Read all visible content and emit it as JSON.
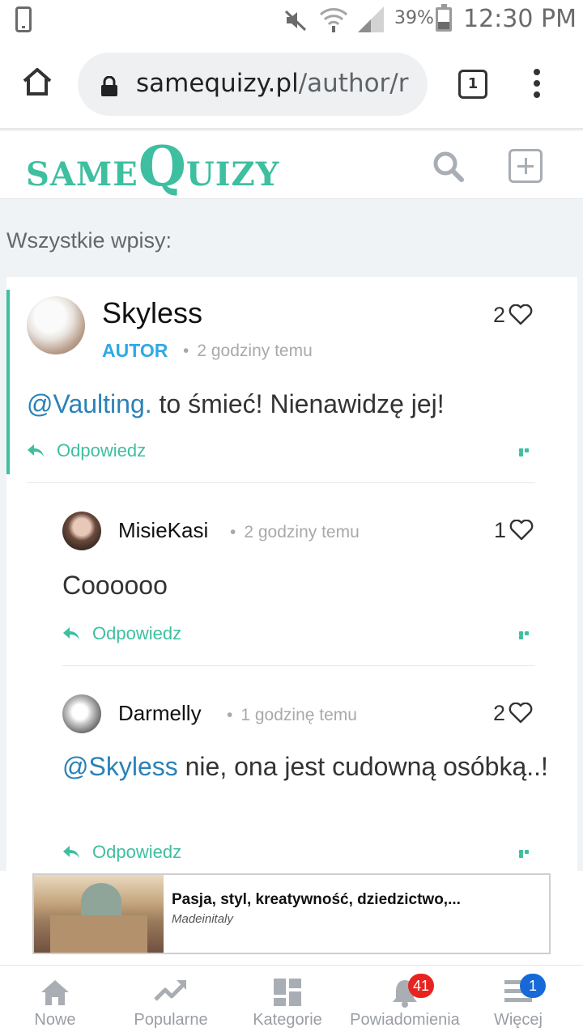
{
  "status_bar": {
    "battery_percent": "39%",
    "time": "12:30 PM"
  },
  "browser": {
    "url_domain": "samequizy.pl",
    "url_path": "/author/r",
    "tab_count": "1"
  },
  "site": {
    "logo_part1": "SAME",
    "logo_q": "Q",
    "logo_part2": "UIZY",
    "brand_color": "#3dbfa0"
  },
  "section_title": "Wszystkie wpisy:",
  "comments": [
    {
      "username": "Skyless",
      "badge": "AUTOR",
      "separator": "•",
      "time": "2 godziny temu",
      "likes": "2",
      "mention": "@Vaulting.",
      "text": " to śmieć! Nienawidzę jej!",
      "reply_label": "Odpowiedz"
    },
    {
      "username": "MisieKasi",
      "separator": "•",
      "time": "2 godziny temu",
      "likes": "1",
      "text": "Coooooo",
      "reply_label": "Odpowiedz"
    },
    {
      "username": "Darmelly",
      "separator": "•",
      "time": "1 godzinę temu",
      "likes": "2",
      "mention": "@Skyless",
      "text": " nie, ona jest cudowną osóbką..!",
      "reply_label": "Odpowiedz"
    }
  ],
  "ad": {
    "title": "Pasja, styl, kreatywność, dziedzictwo,...",
    "source": "Madeinitaly"
  },
  "bottom_nav": [
    {
      "label": "Nowe",
      "icon": "home-icon"
    },
    {
      "label": "Popularne",
      "icon": "trending-icon"
    },
    {
      "label": "Kategorie",
      "icon": "grid-icon"
    },
    {
      "label": "Powiadomienia",
      "icon": "bell-icon",
      "badge": "41"
    },
    {
      "label": "Więcej",
      "icon": "menu-icon",
      "badge": "1"
    }
  ]
}
